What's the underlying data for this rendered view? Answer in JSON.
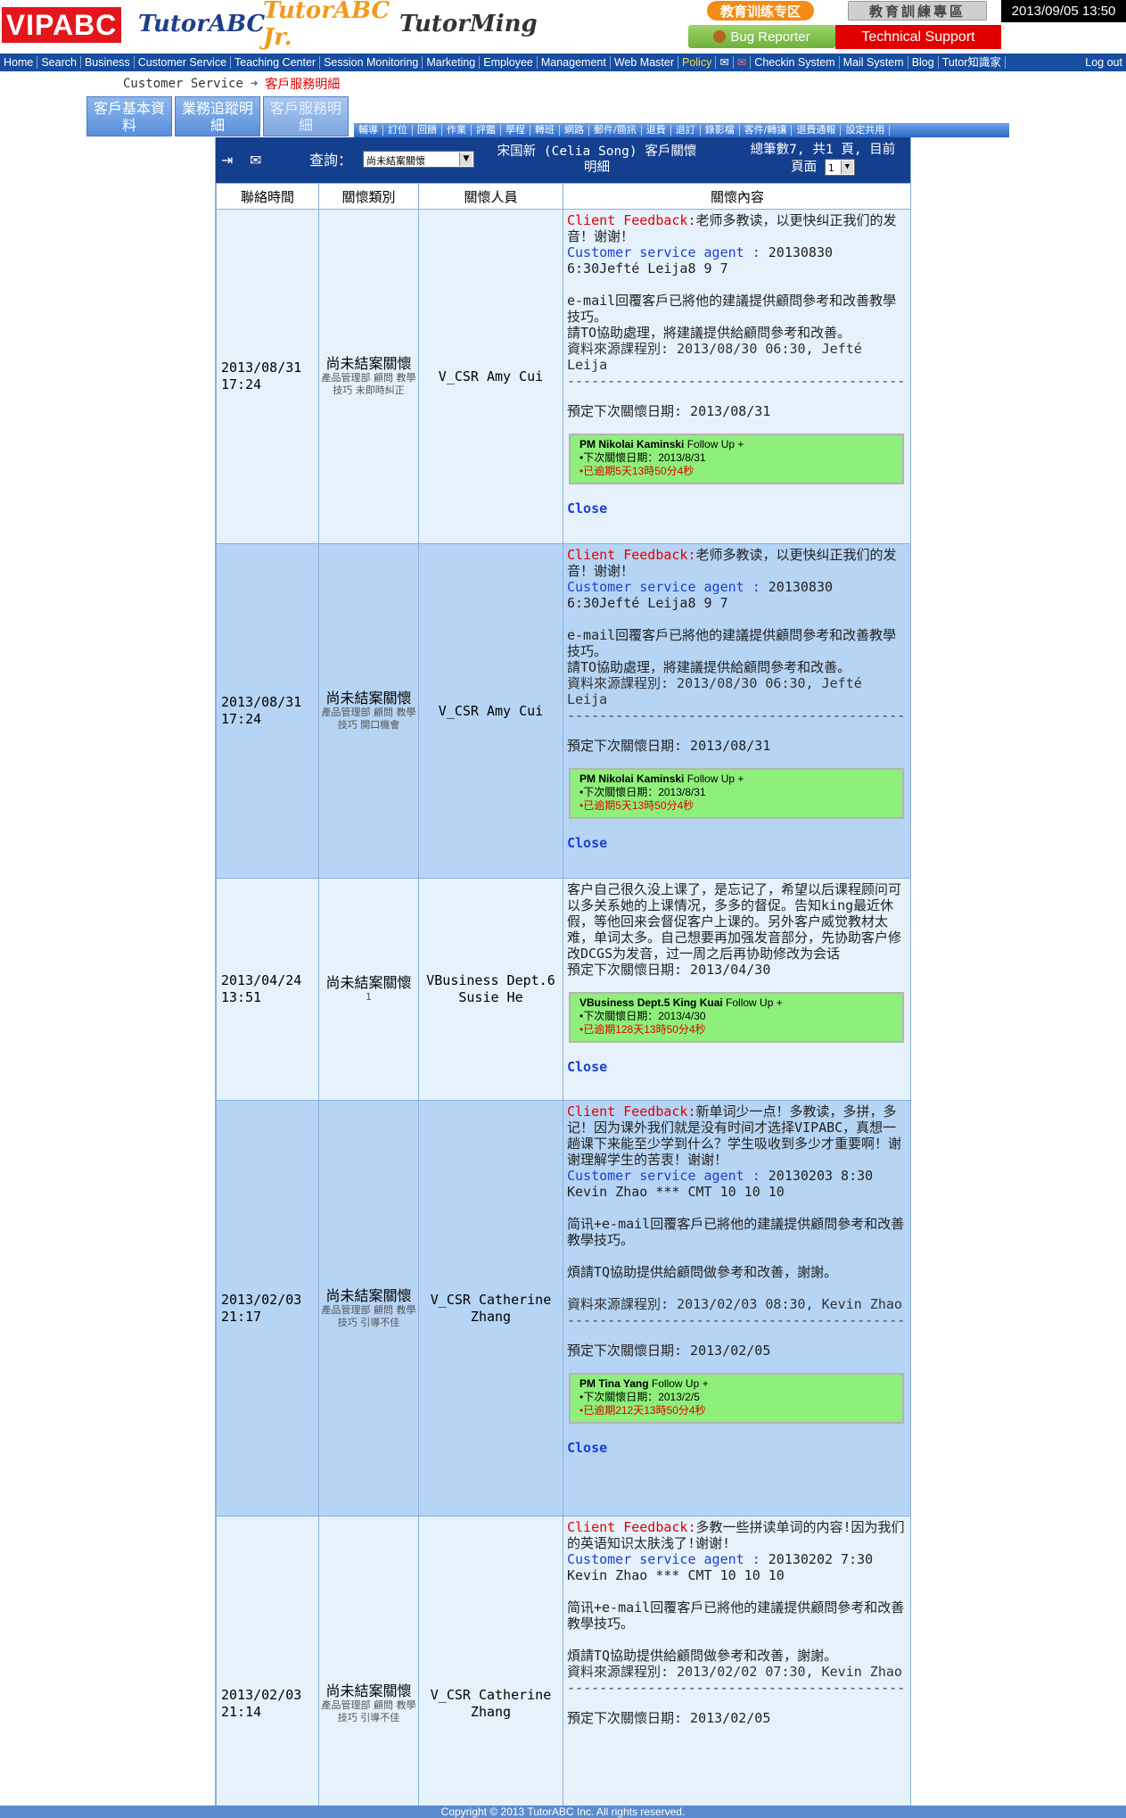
{
  "header": {
    "logos": {
      "vipabc": "VIPABC",
      "tutorabc": "TutorABC",
      "tutorabcjr": "TutorABC Jr.",
      "tutorming": "TutorMing"
    },
    "edu_zone": "教育训练专区",
    "edu_zone_tw": "教育訓練專區",
    "datetime": "2013/09/05 13:50",
    "bug_reporter": "Bug Reporter",
    "tech_support": "Technical Support"
  },
  "nav": {
    "items": [
      "Home",
      "Search",
      "Business",
      "Customer Service",
      "Teaching Center",
      "Session Monitoring",
      "Marketing",
      "Employee",
      "Management",
      "Web Master",
      "Policy",
      "✉",
      "✉",
      "Checkin System",
      "Mail System",
      "Blog",
      "Tutor知識家"
    ],
    "logout": "Log out"
  },
  "breadcrumb": {
    "section": "Customer Service",
    "current": "客戶服務明細"
  },
  "tabs": [
    {
      "label": "客戶基本資料"
    },
    {
      "label": "業務追蹤明細"
    },
    {
      "label": "客戶服務明細"
    }
  ],
  "subnav": [
    "輔導",
    "訂位",
    "回饋",
    "作業",
    "評鑑",
    "學程",
    "轉班",
    "網路",
    "郵件/簡訊",
    "退費",
    "退訂",
    "錄影檔",
    "客件/轉讓",
    "退費通報",
    "設定共用"
  ],
  "query": {
    "label": "查詢：",
    "select_value": "尚未結案關懷",
    "name_line1": "宋国新 (Celia Song) 客戶關懷",
    "name_line2": "明細",
    "count_line1": "總筆數7, 共1 頁, 目前",
    "count_line2": "頁面",
    "page_value": "1"
  },
  "columns": [
    "聯絡時間",
    "關懷類別",
    "關懷人員",
    "關懷內容"
  ],
  "rows": [
    {
      "date": "2013/08/31",
      "time": "17:24",
      "type_main": "尚未結案關懷",
      "type_sub": "產品管理部 顧問 教學技巧 未即時糾正",
      "staff": "V_CSR Amy Cui",
      "feedback_label": "Client Feedback:",
      "feedback_text": "老师多教读，以更快纠正我们的发音！谢谢！",
      "agent_label": "Customer service agent :",
      "agent_text": "20130830 6:30Jefté Leija8 9 7",
      "reply1": "e-mail回覆客戶已將他的建議提供顧問參考和改善教學技巧。",
      "reply2": "請TO協助處理，將建議提供給顧問參考和改善。",
      "source": "資料來源課程別: 2013/08/30 06:30, Jefté Leija",
      "separator": "------------------------------------------",
      "next_date_line": "預定下次關懷日期: 2013/08/31",
      "follow_pm": "PM Nikolai Kaminski",
      "follow_label": "Follow Up +",
      "follow_date": "•下次關懷日期：2013/8/31",
      "follow_overdue": "•已逾期5天13時50分4秒",
      "close_label": "Close"
    },
    {
      "date": "2013/08/31",
      "time": "17:24",
      "type_main": "尚未結案關懷",
      "type_sub": "產品管理部 顧問 教學技巧 開口機會",
      "staff": "V_CSR Amy Cui",
      "feedback_label": "Client Feedback:",
      "feedback_text": "老师多教读，以更快纠正我们的发音！谢谢！",
      "agent_label": "Customer service agent :",
      "agent_text": "20130830 6:30Jefté Leija8 9 7",
      "reply1": "e-mail回覆客戶已將他的建議提供顧問參考和改善教學技巧。",
      "reply2": "請TO協助處理，將建議提供給顧問參考和改善。",
      "source": "資料來源課程別: 2013/08/30 06:30, Jefté Leija",
      "separator": "------------------------------------------",
      "next_date_line": "預定下次關懷日期: 2013/08/31",
      "follow_pm": "PM Nikolai Kaminski",
      "follow_label": "Follow Up +",
      "follow_date": "•下次關懷日期：2013/8/31",
      "follow_overdue": "•已逾期5天13時50分4秒",
      "close_label": "Close"
    },
    {
      "date": "2013/04/24",
      "time": "13:51",
      "type_main": "尚未結案關懷",
      "type_sub": "1",
      "staff": "VBusiness Dept.6 Susie He",
      "note": "客户自己很久没上课了，是忘记了，希望以后课程顾问可以多关系她的上课情况，多多的督促。告知king最近休假，等他回来会督促客户上课的。另外客户威觉教材太难，单词太多。自己想要再加强发音部分，先协助客户修改DCGS为发音，过一周之后再协助修改为会话",
      "next_date_line": "預定下次關懷日期: 2013/04/30",
      "follow_pm": "VBusiness Dept.5 King Kuai",
      "follow_label": "Follow Up +",
      "follow_date": "•下次關懷日期：2013/4/30",
      "follow_overdue": "•已逾期128天13時50分4秒",
      "close_label": "Close"
    },
    {
      "date": "2013/02/03",
      "time": "21:17",
      "type_main": "尚未結案關懷",
      "type_sub": "產品管理部 顧問 教學技巧 引導不佳",
      "staff": "V_CSR Catherine Zhang",
      "feedback_label": "Client Feedback:",
      "feedback_text": "新单词少一点！多教读，多拼，多记！因为课外我们就是没有时间才选择VIPABC，真想一趟课下来能至少学到什么？学生吸收到多少才重要啊！谢谢理解学生的苦衷！谢谢！",
      "agent_label": "Customer service agent :",
      "agent_text": "20130203 8:30 Kevin Zhao *** CMT 10 10 10",
      "reply1": "简讯+e-mail回覆客戶已將他的建議提供顧問參考和改善教學技巧。",
      "reply2": "煩請TQ協助提供給顧問做參考和改善，謝謝。",
      "source": "資料來源課程別: 2013/02/03 08:30, Kevin Zhao",
      "separator": "------------------------------------------",
      "next_date_line": "預定下次關懷日期: 2013/02/05",
      "follow_pm": "PM Tina Yang",
      "follow_label": "Follow Up +",
      "follow_date": "•下次關懷日期：2013/2/5",
      "follow_overdue": "•已逾期212天13時50分4秒",
      "close_label": "Close"
    },
    {
      "date": "2013/02/03",
      "time": "21:14",
      "type_main": "尚未結案關懷",
      "type_sub": "產品管理部 顧問 教學技巧 引導不佳",
      "staff": "V_CSR Catherine Zhang",
      "feedback_label": "Client Feedback:",
      "feedback_text": "多教一些拼读单词的内容!因为我们的英语知识太肤浅了!谢谢!",
      "agent_label": "Customer service agent :",
      "agent_text": "20130202 7:30 Kevin Zhao *** CMT 10 10 10",
      "reply1": "简讯+e-mail回覆客戶已將他的建議提供顧問參考和改善教學技巧。",
      "reply2": "煩請TQ協助提供給顧問做參考和改善，謝謝。",
      "source": "資料來源課程別: 2013/02/02 07:30, Kevin Zhao",
      "separator": "------------------------------------------",
      "next_date_line": "預定下次關懷日期: 2013/02/05"
    }
  ],
  "footer": "Copyright © 2013 TutorABC Inc. All rights reserved."
}
